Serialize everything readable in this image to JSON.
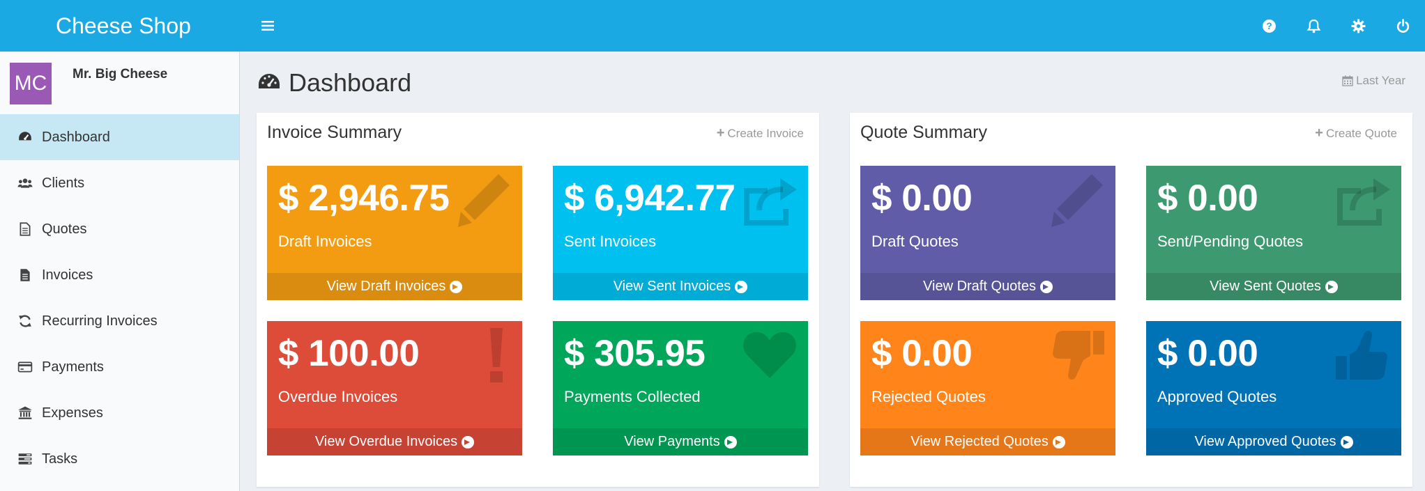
{
  "app": {
    "brand": "Cheese Shop"
  },
  "user": {
    "initials": "MC",
    "name": "Mr. Big Cheese"
  },
  "sidebar": {
    "items": [
      {
        "label": "Dashboard",
        "icon": "dashboard-icon",
        "active": true
      },
      {
        "label": "Clients",
        "icon": "users-icon"
      },
      {
        "label": "Quotes",
        "icon": "file-icon"
      },
      {
        "label": "Invoices",
        "icon": "file-text-icon"
      },
      {
        "label": "Recurring Invoices",
        "icon": "refresh-icon"
      },
      {
        "label": "Payments",
        "icon": "credit-card-icon"
      },
      {
        "label": "Expenses",
        "icon": "bank-icon"
      },
      {
        "label": "Tasks",
        "icon": "tasks-icon"
      }
    ]
  },
  "header": {
    "title": "Dashboard",
    "date_range": "Last Year"
  },
  "invoice_summary": {
    "title": "Invoice Summary",
    "action": "Create Invoice",
    "tiles": [
      {
        "amount": "$ 2,946.75",
        "label": "Draft Invoices",
        "link": "View Draft Invoices",
        "color": "#f39c12",
        "footer_color": "#da8c10",
        "icon": "pencil-icon"
      },
      {
        "amount": "$ 6,942.77",
        "label": "Sent Invoices",
        "link": "View Sent Invoices",
        "color": "#00c0ef",
        "footer_color": "#00acd6",
        "icon": "share-icon"
      },
      {
        "amount": "$ 100.00",
        "label": "Overdue Invoices",
        "link": "View Overdue Invoices",
        "color": "#dd4b39",
        "footer_color": "#c64333",
        "icon": "exclamation-icon"
      },
      {
        "amount": "$ 305.95",
        "label": "Payments Collected",
        "link": "View Payments",
        "color": "#00a65a",
        "footer_color": "#009551",
        "icon": "heart-icon"
      }
    ]
  },
  "quote_summary": {
    "title": "Quote Summary",
    "action": "Create Quote",
    "tiles": [
      {
        "amount": "$ 0.00",
        "label": "Draft Quotes",
        "link": "View Draft Quotes",
        "color": "#605ca8",
        "footer_color": "#565397",
        "icon": "pencil-icon"
      },
      {
        "amount": "$ 0.00",
        "label": "Sent/Pending Quotes",
        "link": "View Sent Quotes",
        "color": "#3d9970",
        "footer_color": "#378963",
        "icon": "share-icon"
      },
      {
        "amount": "$ 0.00",
        "label": "Rejected Quotes",
        "link": "View Rejected Quotes",
        "color": "#ff851b",
        "footer_color": "#e67718",
        "icon": "thumbs-down-icon"
      },
      {
        "amount": "$ 0.00",
        "label": "Approved Quotes",
        "link": "View Approved Quotes",
        "color": "#0073b7",
        "footer_color": "#0067a4",
        "icon": "thumbs-up-icon"
      }
    ]
  }
}
